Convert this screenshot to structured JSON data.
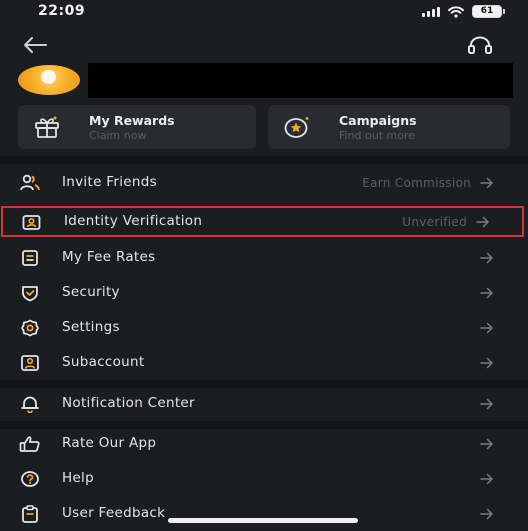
{
  "status_bar": {
    "time": "22:09",
    "battery": "61"
  },
  "nav": {
    "back_icon": "arrow-left-icon",
    "support_icon": "headset-icon"
  },
  "profile": {
    "avatar_color": "#f6a921"
  },
  "cards": [
    {
      "title": "My Rewards",
      "subtitle": "Claim now",
      "icon": "gift-icon"
    },
    {
      "title": "Campaigns",
      "subtitle": "Find out more",
      "icon": "star-badge-icon"
    }
  ],
  "menu": [
    {
      "label": "Invite Friends",
      "value": "Earn Commission",
      "icon": "users-icon"
    },
    {
      "label": "Identity Verification",
      "value": "Unverified",
      "icon": "id-card-icon",
      "highlighted": true
    },
    {
      "label": "My Fee Rates",
      "value": "",
      "icon": "receipt-icon"
    },
    {
      "label": "Security",
      "value": "",
      "icon": "shield-icon"
    },
    {
      "label": "Settings",
      "value": "",
      "icon": "gear-icon"
    },
    {
      "label": "Subaccount",
      "value": "",
      "icon": "user-box-icon"
    },
    {
      "label": "Notification Center",
      "value": "",
      "icon": "bell-icon"
    },
    {
      "label": "Rate Our App",
      "value": "",
      "icon": "thumbs-up-icon"
    },
    {
      "label": "Help",
      "value": "",
      "icon": "help-icon"
    },
    {
      "label": "User Feedback",
      "value": "",
      "icon": "clipboard-icon"
    }
  ],
  "colors": {
    "background": "#1c1d21",
    "card": "#2a2b30",
    "highlight_border": "#d23434",
    "muted_text": "#5d5f64"
  }
}
